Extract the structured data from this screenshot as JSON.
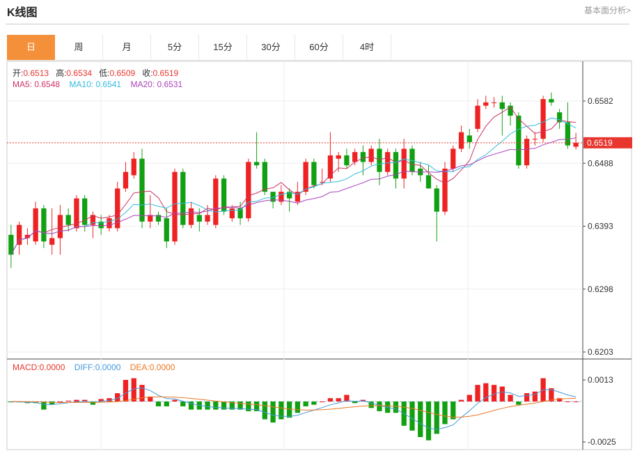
{
  "header": {
    "title": "K线图",
    "link": "基本面分析>"
  },
  "tabs": [
    {
      "label": "日",
      "active": true
    },
    {
      "label": "周"
    },
    {
      "label": "月"
    },
    {
      "label": "5分"
    },
    {
      "label": "15分"
    },
    {
      "label": "30分"
    },
    {
      "label": "60分"
    },
    {
      "label": "4时"
    }
  ],
  "ohlc": {
    "open_label": "开:",
    "open": "0.6513",
    "high_label": "高:",
    "high": "0.6534",
    "low_label": "低:",
    "low": "0.6509",
    "close_label": "收:",
    "close": "0.6519"
  },
  "ma": {
    "ma5": "MA5: 0.6548",
    "ma10": "MA10: 0.6541",
    "ma20": "MA20: 0.6531"
  },
  "macd": {
    "macd": "MACD:0.0000",
    "diff": "DIFF:0.0000",
    "dea": "DEA:0.0000"
  },
  "colors": {
    "up": "#ee2222",
    "down": "#11a011",
    "ma5": "#cc3366",
    "ma10": "#33bbdd",
    "ma20": "#aa44bb",
    "diff": "#4499dd",
    "dea": "#ee7722",
    "accent": "#f4903a"
  },
  "chart_data": {
    "type": "candlestick",
    "price_axis": {
      "ticks": [
        "0.6582",
        "0.6488",
        "0.6393",
        "0.6298",
        "0.6203"
      ],
      "range": [
        0.6203,
        0.6582
      ]
    },
    "last_price": "0.6519",
    "macd_axis": {
      "ticks": [
        "0.0013",
        "-0.0025"
      ]
    },
    "candles": [
      [
        0.638,
        0.635,
        0.6395,
        0.633
      ],
      [
        0.6365,
        0.6395,
        0.64,
        0.635
      ],
      [
        0.6375,
        0.638,
        0.639,
        0.6365
      ],
      [
        0.637,
        0.642,
        0.643,
        0.6365
      ],
      [
        0.642,
        0.637,
        0.6425,
        0.636
      ],
      [
        0.6365,
        0.6375,
        0.642,
        0.635
      ],
      [
        0.6375,
        0.641,
        0.6425,
        0.635
      ],
      [
        0.641,
        0.6395,
        0.642,
        0.6385
      ],
      [
        0.639,
        0.6435,
        0.644,
        0.6385
      ],
      [
        0.6435,
        0.6395,
        0.644,
        0.6385
      ],
      [
        0.6395,
        0.641,
        0.6415,
        0.6375
      ],
      [
        0.64,
        0.639,
        0.641,
        0.638
      ],
      [
        0.639,
        0.6405,
        0.641,
        0.6385
      ],
      [
        0.639,
        0.645,
        0.646,
        0.6385
      ],
      [
        0.645,
        0.6475,
        0.649,
        0.6445
      ],
      [
        0.647,
        0.6495,
        0.6505,
        0.6465
      ],
      [
        0.6495,
        0.64,
        0.651,
        0.639
      ],
      [
        0.64,
        0.641,
        0.644,
        0.639
      ],
      [
        0.641,
        0.64,
        0.6415,
        0.6395
      ],
      [
        0.6405,
        0.637,
        0.642,
        0.636
      ],
      [
        0.637,
        0.6475,
        0.648,
        0.6365
      ],
      [
        0.6475,
        0.6395,
        0.648,
        0.639
      ],
      [
        0.6395,
        0.642,
        0.643,
        0.639
      ],
      [
        0.641,
        0.64,
        0.642,
        0.6385
      ],
      [
        0.64,
        0.641,
        0.6425,
        0.6395
      ],
      [
        0.6395,
        0.6465,
        0.647,
        0.639
      ],
      [
        0.6465,
        0.6415,
        0.647,
        0.641
      ],
      [
        0.6405,
        0.642,
        0.6425,
        0.64
      ],
      [
        0.642,
        0.6405,
        0.643,
        0.6395
      ],
      [
        0.6405,
        0.649,
        0.6495,
        0.64
      ],
      [
        0.649,
        0.6485,
        0.6535,
        0.648
      ],
      [
        0.649,
        0.6445,
        0.6495,
        0.644
      ],
      [
        0.6445,
        0.643,
        0.6445,
        0.642
      ],
      [
        0.643,
        0.6445,
        0.6455,
        0.6425
      ],
      [
        0.6445,
        0.6435,
        0.645,
        0.6415
      ],
      [
        0.643,
        0.6445,
        0.646,
        0.6425
      ],
      [
        0.6445,
        0.649,
        0.6495,
        0.644
      ],
      [
        0.649,
        0.6455,
        0.6495,
        0.645
      ],
      [
        0.646,
        0.646,
        0.648,
        0.6455
      ],
      [
        0.6465,
        0.65,
        0.6535,
        0.646
      ],
      [
        0.6495,
        0.65,
        0.6505,
        0.6475
      ],
      [
        0.65,
        0.6485,
        0.651,
        0.648
      ],
      [
        0.649,
        0.6505,
        0.651,
        0.6485
      ],
      [
        0.6505,
        0.649,
        0.6515,
        0.647
      ],
      [
        0.649,
        0.651,
        0.6515,
        0.6485
      ],
      [
        0.651,
        0.6475,
        0.6525,
        0.6455
      ],
      [
        0.6475,
        0.6505,
        0.651,
        0.647
      ],
      [
        0.6505,
        0.6465,
        0.651,
        0.645
      ],
      [
        0.6465,
        0.651,
        0.6525,
        0.645
      ],
      [
        0.651,
        0.6475,
        0.6515,
        0.647
      ],
      [
        0.648,
        0.647,
        0.649,
        0.646
      ],
      [
        0.647,
        0.645,
        0.6485,
        0.645
      ],
      [
        0.645,
        0.6415,
        0.6455,
        0.637
      ],
      [
        0.6415,
        0.648,
        0.649,
        0.641
      ],
      [
        0.648,
        0.651,
        0.6515,
        0.6475
      ],
      [
        0.651,
        0.6535,
        0.6545,
        0.6505
      ],
      [
        0.653,
        0.652,
        0.654,
        0.651
      ],
      [
        0.654,
        0.6575,
        0.6585,
        0.6535
      ],
      [
        0.6575,
        0.658,
        0.659,
        0.657
      ],
      [
        0.658,
        0.658,
        0.6588,
        0.6572
      ],
      [
        0.658,
        0.657,
        0.659,
        0.653
      ],
      [
        0.6575,
        0.656,
        0.658,
        0.6545
      ],
      [
        0.656,
        0.6485,
        0.6565,
        0.648
      ],
      [
        0.6485,
        0.6525,
        0.653,
        0.648
      ],
      [
        0.6525,
        0.6525,
        0.6535,
        0.6515
      ],
      [
        0.6525,
        0.6585,
        0.659,
        0.652
      ],
      [
        0.6585,
        0.658,
        0.6595,
        0.6575
      ],
      [
        0.6565,
        0.655,
        0.657,
        0.654
      ],
      [
        0.655,
        0.6515,
        0.658,
        0.651
      ],
      [
        0.6513,
        0.6519,
        0.6534,
        0.6509
      ]
    ],
    "macd_bars": [
      -5e-05,
      -5e-05,
      -0.0001,
      -0.0001,
      -0.0005,
      -0.0002,
      0.0,
      5e-05,
      0.0001,
      0.0001,
      -0.0002,
      0.00015,
      0.0002,
      0.0005,
      0.0013,
      0.0014,
      0.001,
      0.0003,
      -0.0003,
      -0.0003,
      0.0001,
      -0.0003,
      -0.0005,
      -0.0005,
      -0.0005,
      -0.0005,
      -0.0005,
      -0.0005,
      -0.0005,
      -0.0006,
      -0.0006,
      -0.0011,
      -0.0013,
      -0.0011,
      -0.001,
      -0.0007,
      -0.0003,
      -0.0002,
      0.0,
      0.0002,
      0.0002,
      0.0004,
      -0.0001,
      0.0001,
      -0.0004,
      -0.0006,
      -0.0007,
      -0.0007,
      -0.0015,
      -0.0018,
      -0.0022,
      -0.0024,
      -0.002,
      -0.0014,
      -0.0011,
      0.0001,
      0.0004,
      0.001,
      0.0011,
      0.001,
      0.0009,
      0.0004,
      -0.0002,
      0.0005,
      0.0006,
      0.0014,
      0.0008,
      0.0002,
      0.0,
      0.0
    ],
    "xlabel": "",
    "ylabel": ""
  }
}
